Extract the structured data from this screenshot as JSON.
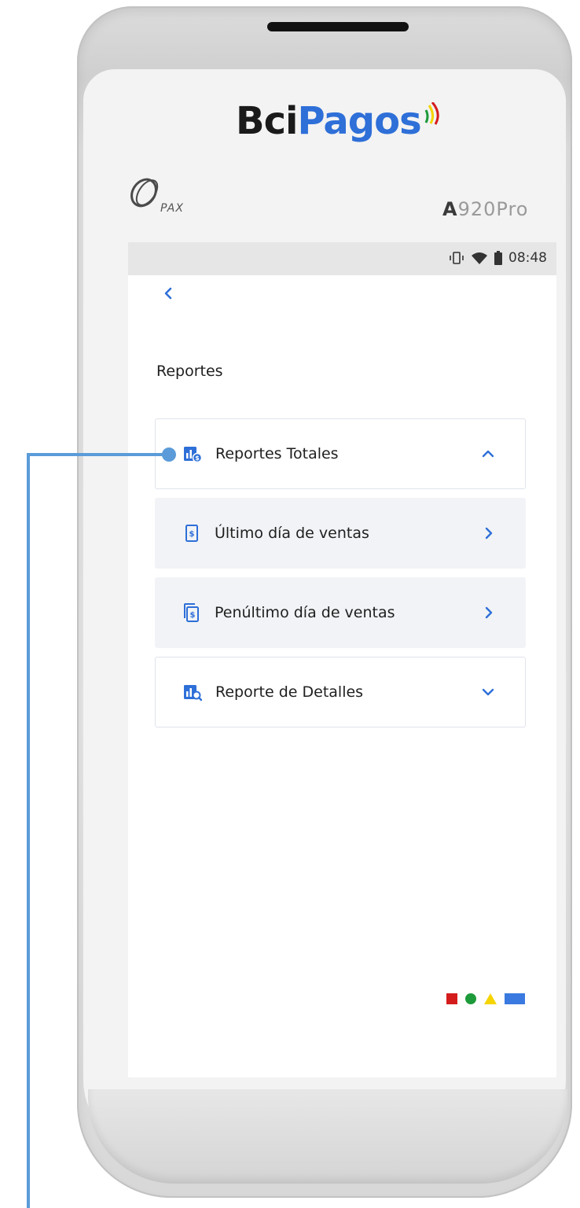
{
  "device": {
    "brand_part1": "Bci",
    "brand_part2": "Pagos",
    "maker": "PAX",
    "model_bold": "A",
    "model_rest": "920Pro"
  },
  "status_bar": {
    "time": "08:48",
    "icons": [
      "vibrate-icon",
      "wifi-icon",
      "battery-icon"
    ]
  },
  "header": {
    "back_icon": "chevron-left-icon",
    "title": "Reportes"
  },
  "menu": {
    "items": [
      {
        "label": "Reportes Totales",
        "icon": "report-totals-icon",
        "chevron": "chevron-up-icon",
        "expanded": true
      },
      {
        "label": "Último día de ventas",
        "icon": "receipt-icon",
        "chevron": "chevron-right-icon"
      },
      {
        "label": "Penúltimo día de ventas",
        "icon": "receipts-stack-icon",
        "chevron": "chevron-right-icon"
      },
      {
        "label": "Reporte de Detalles",
        "icon": "report-search-icon",
        "chevron": "chevron-down-icon",
        "expanded": false
      }
    ]
  },
  "colors": {
    "accent": "#2e6fd8",
    "callout": "#5b9bd9",
    "brand_dots": [
      "#d51c1c",
      "#1d9a3a",
      "#f5d400",
      "#3a7ae0"
    ]
  }
}
